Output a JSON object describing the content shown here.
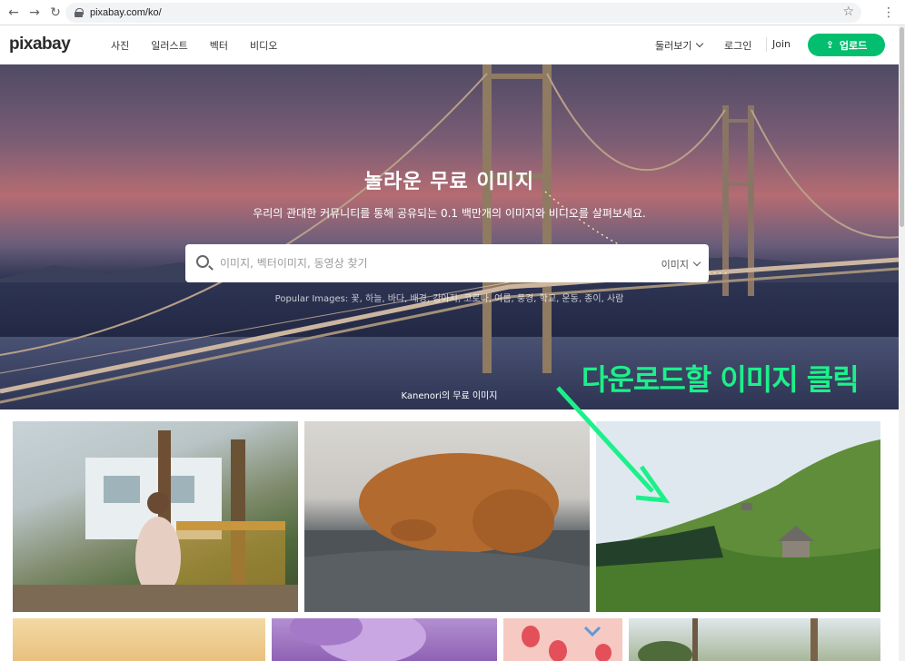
{
  "browser": {
    "url": "pixabay.com/ko/"
  },
  "header": {
    "logo": "pixabay",
    "nav": [
      "사진",
      "일러스트",
      "벡터",
      "비디오"
    ],
    "explore": "둘러보기",
    "login": "로그인",
    "join": "Join",
    "upload": "업로드"
  },
  "hero": {
    "title": "놀라운 무료 이미지",
    "subtitle": "우리의 관대한 커뮤니티를 통해 공유되는 0.1 백만개의 이미지와 비디오를 살펴보세요.",
    "search_placeholder": "이미지, 벡터이미지, 동영상 찾기",
    "search_type": "이미지",
    "popular": "Popular Images: 꽃, 하늘, 바다, 배경, 강아지, 코로나, 여름, 풍경, 학교, 운동, 종이, 사람",
    "credit": "Kanenori의 무료 이미지"
  },
  "annotation": {
    "text": "다운로드할 이미지 클릭",
    "color": "#1cf08a"
  },
  "colors": {
    "accent": "#02be6e"
  }
}
